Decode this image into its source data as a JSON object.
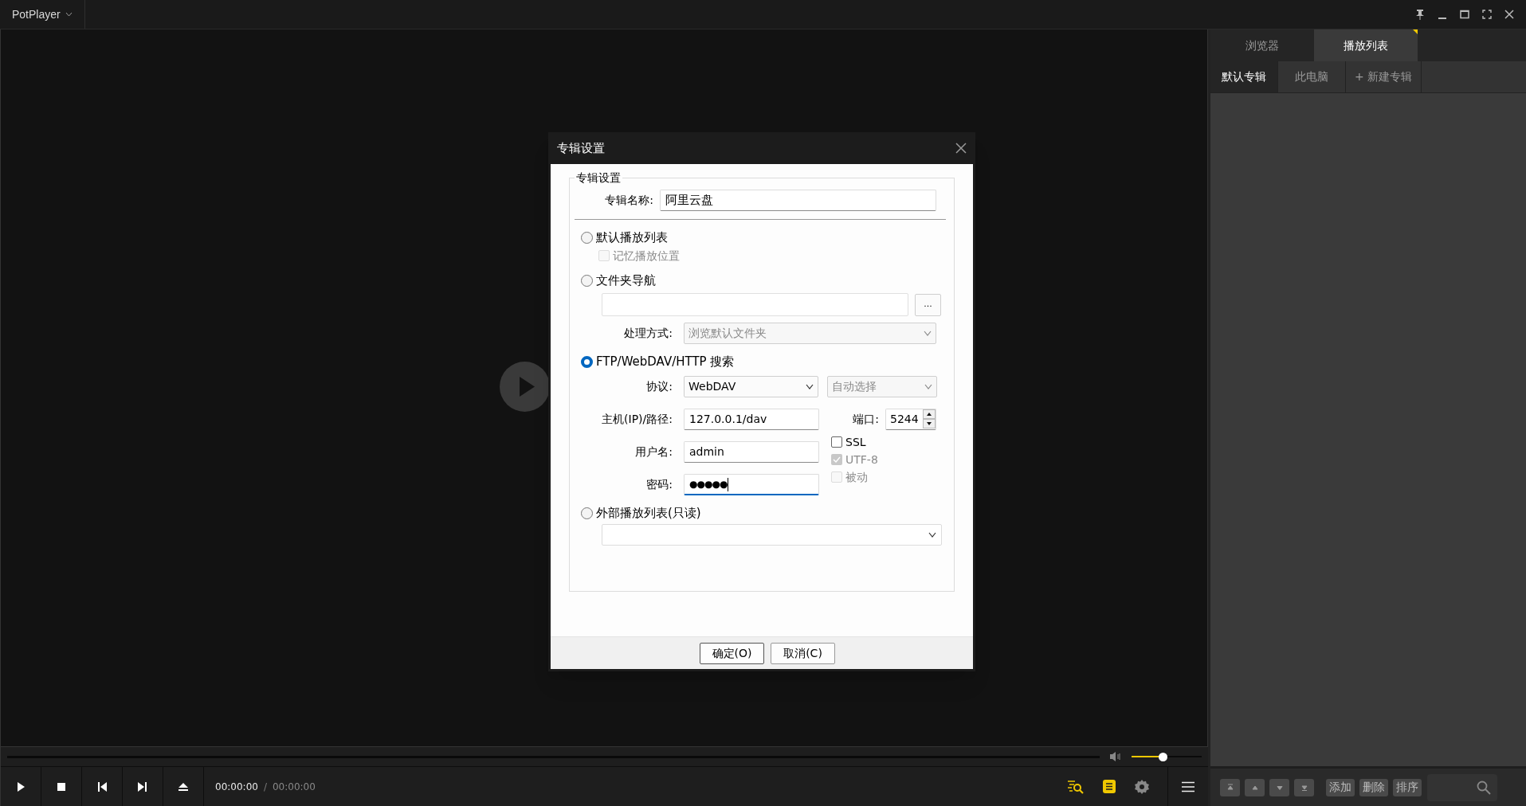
{
  "app": {
    "title": "PotPlayer"
  },
  "panel": {
    "tabs": [
      {
        "label": "浏览器",
        "selected": false
      },
      {
        "label": "播放列表",
        "selected": true
      }
    ],
    "album_tabs": [
      {
        "label": "默认专辑",
        "selected": true
      },
      {
        "label": "此电脑",
        "selected": false
      },
      {
        "label": "+ 新建专辑",
        "selected": false
      }
    ],
    "buttons": [
      "添加",
      "删除",
      "排序"
    ]
  },
  "dialog": {
    "title": "专辑设置",
    "group_title": "专辑设置",
    "name_label": "专辑名称:",
    "name_value": "阿里云盘",
    "sources": [
      {
        "kind": "default",
        "label": "默认播放列表",
        "selected": false,
        "remember": {
          "label": "记忆播放位置",
          "checked": false,
          "disabled": true
        }
      },
      {
        "kind": "folder",
        "label": "文件夹导航",
        "selected": false,
        "browse_button": "...",
        "mode_label": "处理方式:",
        "mode_value": "浏览默认文件夹",
        "mode_disabled": true
      },
      {
        "kind": "remote",
        "label": "FTP/WebDAV/HTTP 搜索",
        "selected": true,
        "protocol_label": "协议:",
        "protocol_value": "WebDAV",
        "encoding_value": "自动选择",
        "encoding_disabled": true,
        "host_label": "主机(IP)/路径:",
        "host_value": "127.0.0.1/dav",
        "port_label": "端口:",
        "port_value": "5244",
        "user_label": "用户名:",
        "user_value": "admin",
        "password_label": "密码:",
        "password_value": "●●●●●",
        "password_focused": true,
        "options": [
          {
            "label": "SSL",
            "checked": false,
            "disabled": false
          },
          {
            "label": "UTF-8",
            "checked": true,
            "disabled": true
          },
          {
            "label": "被动",
            "checked": false,
            "disabled": true
          }
        ]
      },
      {
        "kind": "external",
        "label": "外部播放列表(只读)",
        "selected": false
      }
    ],
    "buttons": [
      "确定(O)",
      "取消(C)"
    ]
  },
  "controls": {
    "time_current": "00:00:00",
    "separator": "/",
    "time_total": "00:00:00",
    "volume": {
      "level": 0.44
    }
  }
}
